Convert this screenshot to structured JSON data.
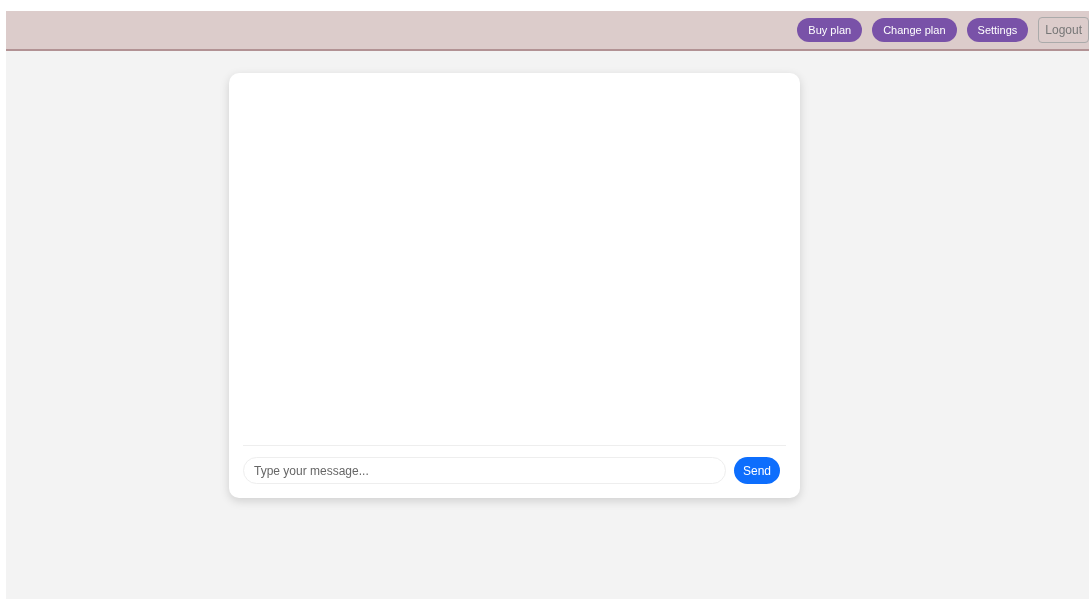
{
  "header": {
    "buttons": [
      {
        "label": "Buy plan",
        "kind": "pill"
      },
      {
        "label": "Change plan",
        "kind": "pill"
      },
      {
        "label": "Settings",
        "kind": "pill"
      },
      {
        "label": "Logout",
        "kind": "outline"
      }
    ]
  },
  "chat": {
    "input": {
      "placeholder": "Type your message..."
    },
    "send": "Send"
  }
}
